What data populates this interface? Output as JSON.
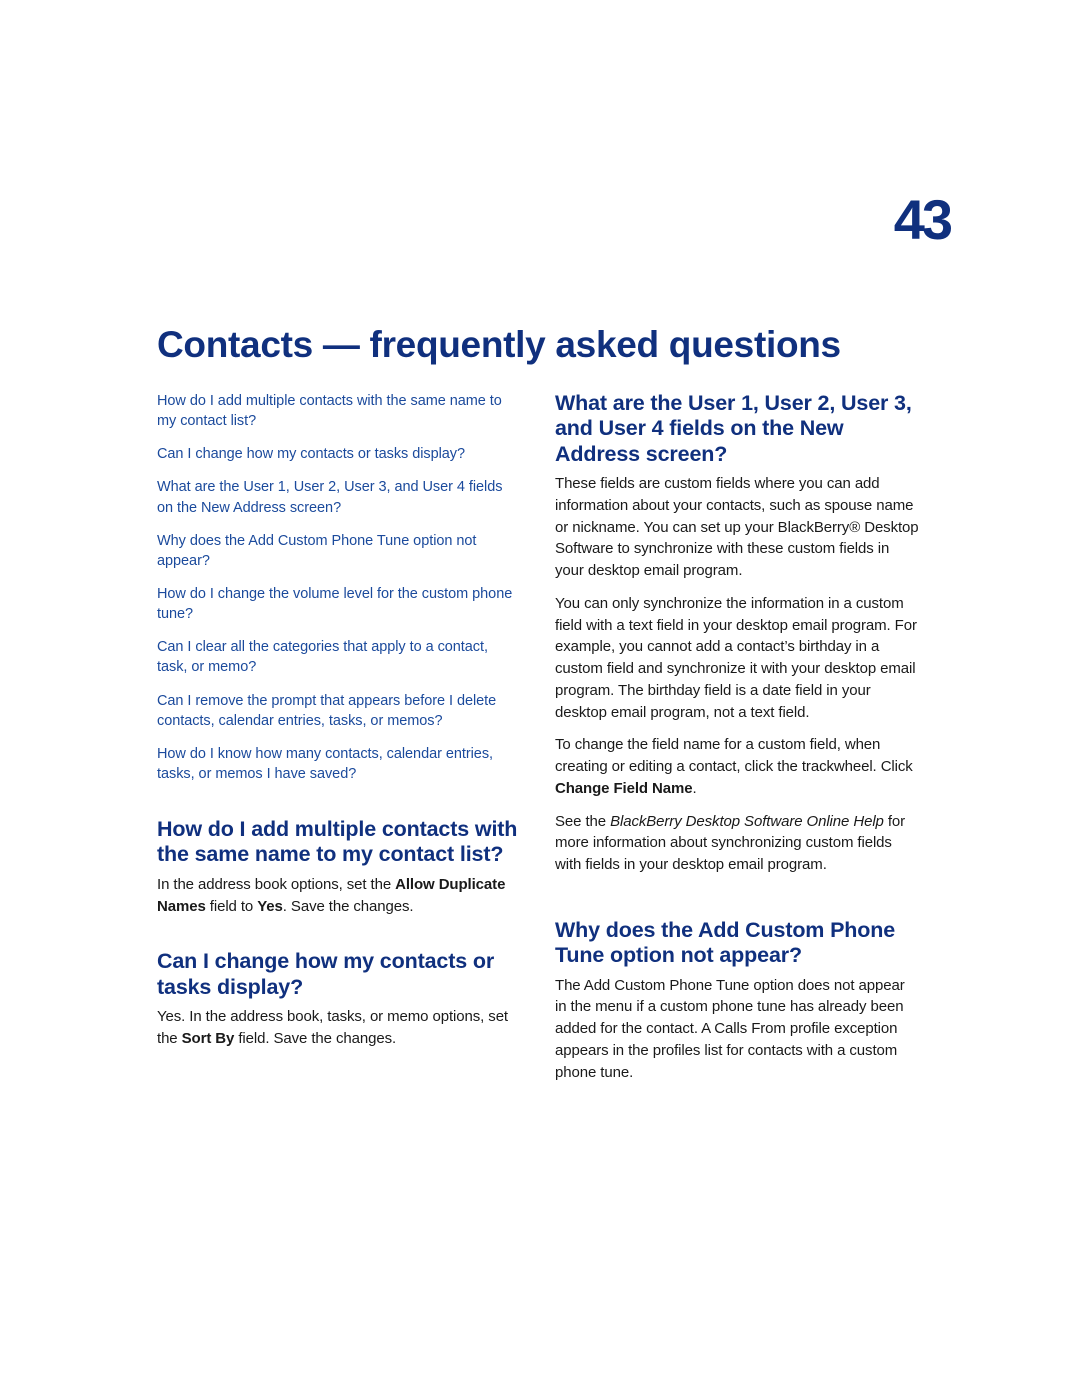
{
  "page": {
    "number": "43",
    "title": "Contacts — frequently asked questions",
    "colors": {
      "heading_blue": "#10307e",
      "toc_link_blue": "#1b4a9c",
      "body_text": "#1a1a1a",
      "background": "#ffffff"
    }
  },
  "toc": {
    "items": [
      "How do I add multiple contacts with the same name to my contact list?",
      "Can I change how my contacts or tasks display?",
      "What are the User 1, User 2, User 3, and User 4 fields on the New Address screen?",
      "Why does the Add Custom Phone Tune option not appear?",
      "How do I change the volume level for the custom phone tune?",
      "Can I clear all the categories that apply to a contact, task, or memo?",
      "Can I remove the prompt that appears before I delete contacts, calendar entries, tasks, or memos?",
      "How do I know how many contacts, calendar entries, tasks, or memos I have saved?"
    ]
  },
  "left_column": {
    "sections": [
      {
        "heading": "How do I add multiple contacts with the same name to my contact list?",
        "paragraphs": [
          {
            "runs": [
              {
                "text": "In the address book options, set the ",
                "style": "normal"
              },
              {
                "text": "Allow Duplicate Names",
                "style": "bold"
              },
              {
                "text": " field to ",
                "style": "normal"
              },
              {
                "text": "Yes",
                "style": "bold"
              },
              {
                "text": ". Save the changes.",
                "style": "normal"
              }
            ]
          }
        ]
      },
      {
        "heading": "Can I change how my contacts or tasks display?",
        "paragraphs": [
          {
            "runs": [
              {
                "text": "Yes. In the address book, tasks, or memo options, set the ",
                "style": "normal"
              },
              {
                "text": "Sort By",
                "style": "bold"
              },
              {
                "text": " field. Save the changes.",
                "style": "normal"
              }
            ]
          }
        ]
      }
    ]
  },
  "right_column": {
    "sections": [
      {
        "heading": "What are the User 1, User 2, User 3, and User 4 fields on the New Address screen?",
        "paragraphs": [
          {
            "runs": [
              {
                "text": "These fields are custom fields where you can add information about your contacts, such as spouse name or nickname. You can set up your BlackBerry® Desktop Software to synchronize with these custom fields in your desktop email program.",
                "style": "normal"
              }
            ]
          },
          {
            "runs": [
              {
                "text": "You can only synchronize the information in a custom field with a text field in your desktop email program. For example, you cannot add a contact’s birthday in a custom field and synchronize it with your desktop email program. The birthday field is a date field in your desktop email program, not a text field.",
                "style": "normal"
              }
            ]
          },
          {
            "runs": [
              {
                "text": "To change the field name for a custom field, when creating or editing a contact, click the trackwheel. Click ",
                "style": "normal"
              },
              {
                "text": "Change Field Name",
                "style": "bold"
              },
              {
                "text": ".",
                "style": "normal"
              }
            ]
          },
          {
            "runs": [
              {
                "text": "See the ",
                "style": "normal"
              },
              {
                "text": "BlackBerry Desktop Software Online Help",
                "style": "italic"
              },
              {
                "text": " for more information about synchronizing custom fields with fields in your desktop email program.",
                "style": "normal"
              }
            ]
          }
        ]
      },
      {
        "heading": "Why does the Add Custom Phone Tune option not appear?",
        "paragraphs": [
          {
            "runs": [
              {
                "text": "The Add Custom Phone Tune option does not appear in the menu if a custom phone tune has already been added for the contact. A Calls From profile exception appears in the profiles list for contacts with a custom phone tune.",
                "style": "normal"
              }
            ]
          }
        ]
      }
    ]
  }
}
